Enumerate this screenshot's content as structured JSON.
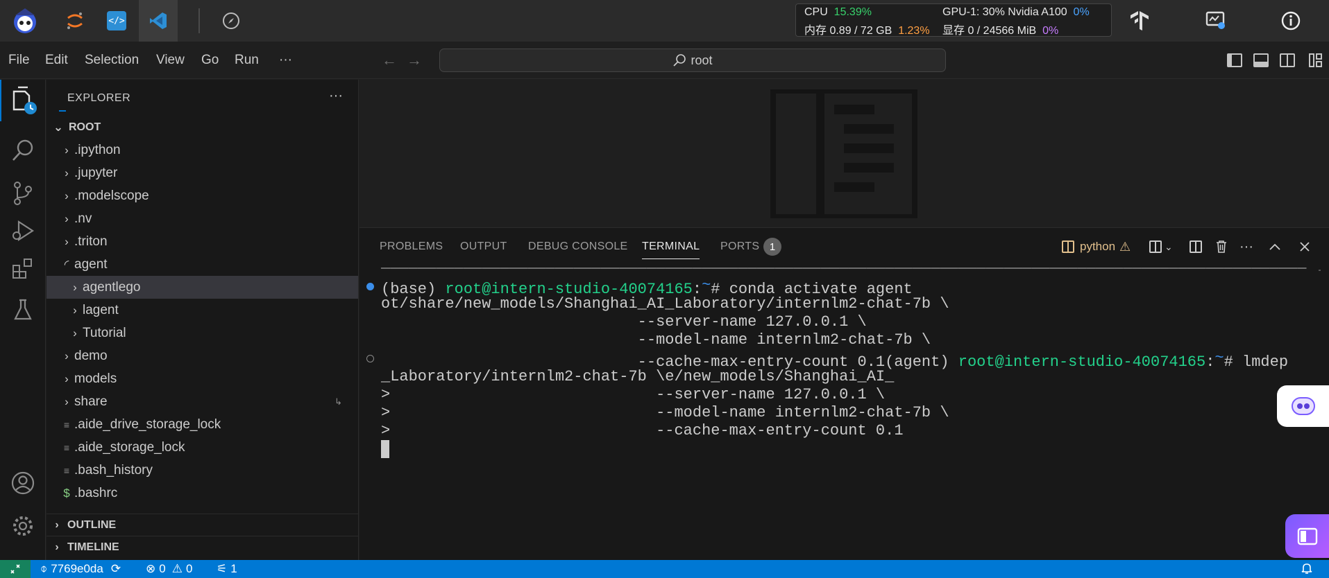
{
  "topbar": {
    "apps": [
      "assistant-mascot-icon",
      "jupyter-icon",
      "code-file-icon",
      "vscode-icon",
      "compass-icon"
    ],
    "cpu_label": "CPU",
    "cpu_value": "15.39%",
    "mem_label": "内存 0.89 / 72 GB",
    "mem_value": "1.23%",
    "gpu_label": "GPU-1: 30% Nvidia A100",
    "gpu_value": "0%",
    "vram_label": "显存 0 / 24566 MiB",
    "vram_value": "0%"
  },
  "menu": {
    "items": [
      "File",
      "Edit",
      "Selection",
      "View",
      "Go",
      "Run",
      "···"
    ],
    "search": "root"
  },
  "explorer": {
    "title": "EXPLORER",
    "more": "···",
    "root": "ROOT",
    "items": [
      {
        "label": ".ipython",
        "type": "folder"
      },
      {
        "label": ".jupyter",
        "type": "folder"
      },
      {
        "label": ".modelscope",
        "type": "folder"
      },
      {
        "label": ".nv",
        "type": "folder"
      },
      {
        "label": ".triton",
        "type": "folder"
      },
      {
        "label": "agent",
        "type": "folder-loading"
      },
      {
        "label": "agentlego",
        "type": "subfolder"
      },
      {
        "label": "lagent",
        "type": "subfolder"
      },
      {
        "label": "Tutorial",
        "type": "subfolder"
      },
      {
        "label": "demo",
        "type": "folder"
      },
      {
        "label": "models",
        "type": "folder"
      },
      {
        "label": "share",
        "type": "folder"
      },
      {
        "label": ".aide_drive_storage_lock",
        "type": "file"
      },
      {
        "label": ".aide_storage_lock",
        "type": "file"
      },
      {
        "label": ".bash_history",
        "type": "file"
      },
      {
        "label": ".bashrc",
        "type": "shell"
      }
    ],
    "outline": "OUTLINE",
    "timeline": "TIMELINE"
  },
  "panel": {
    "tabs": [
      "PROBLEMS",
      "OUTPUT",
      "DEBUG CONSOLE",
      "TERMINAL",
      "PORTS"
    ],
    "active_tab": "TERMINAL",
    "ports_count": "1",
    "terminal_name": "python",
    "warning": "⚠"
  },
  "terminal": {
    "rule": "_____________________________________________________________________________________________________",
    "l1_prefix": "(base) ",
    "l1_user": "root@intern-studio-40074165",
    "l1_colon": ":",
    "l1_path": "~",
    "l1_cmd": "# conda activate agent",
    "l2": "ot/share/new_models/Shanghai_AI_Laboratory/internlm2-chat-7b \\",
    "l3": "                            --server-name 127.0.0.1 \\",
    "l4": "                            --model-name internlm2-chat-7b \\",
    "l5_a": "                            --cache-max-entry-count 0.1(agent) ",
    "l5_user": "root@intern-studio-40074165",
    "l5_colon": ":",
    "l5_path": "~",
    "l5_cmd": "# lmdep",
    "l6": "_Laboratory/internlm2-chat-7b \\e/new_models/Shanghai_AI_",
    "l7": ">                             --server-name 127.0.0.1 \\",
    "l8": ">                             --model-name internlm2-chat-7b \\",
    "l9": ">                             --cache-max-entry-count 0.1"
  },
  "status": {
    "branch": "7769e0da",
    "errors": "0",
    "warnings": "0",
    "ports": "1"
  }
}
